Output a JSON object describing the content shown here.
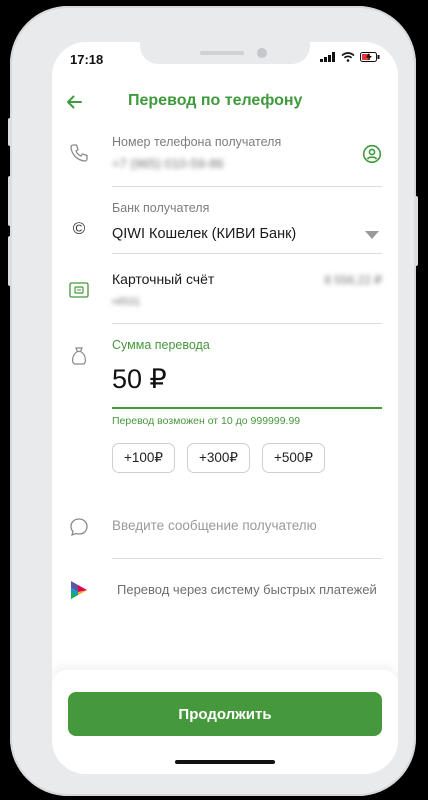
{
  "status": {
    "time": "17:18"
  },
  "header": {
    "title": "Перевод по телефону"
  },
  "phone": {
    "label": "Номер телефона получателя",
    "value": "+7 (965) 010-59-86"
  },
  "bank": {
    "label": "Банк получателя",
    "value": "QIWI Кошелек (КИВИ Банк)"
  },
  "account": {
    "label": "Карточный счёт",
    "balance": "8 556,22 ₽",
    "masked_number": "•4531"
  },
  "amount": {
    "label": "Сумма перевода",
    "value": "50 ₽",
    "hint": "Перевод возможен от 10 до 999999.99"
  },
  "quick_amounts": [
    "+100₽",
    "+300₽",
    "+500₽"
  ],
  "message": {
    "placeholder": "Введите сообщение получателю"
  },
  "sbp": {
    "text": "Перевод через систему быстрых платежей"
  },
  "cta": {
    "label": "Продолжить"
  },
  "colors": {
    "accent": "#46983c",
    "title_green": "#3f9a3d"
  }
}
